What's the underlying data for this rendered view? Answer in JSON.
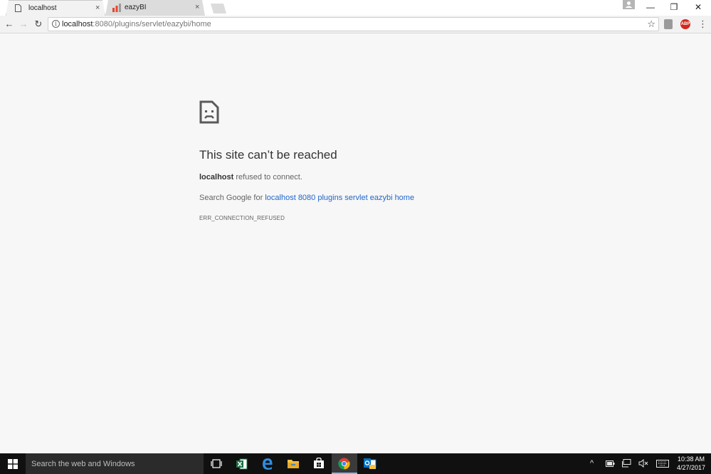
{
  "tabs": [
    {
      "title": "localhost",
      "close": "×",
      "icon": "page-icon"
    },
    {
      "title": "eazyBI",
      "close": "×",
      "icon": "bar-chart-icon"
    }
  ],
  "window_controls": {
    "minimize": "—",
    "restore": "❐",
    "close": "✕"
  },
  "toolbar": {
    "back": "←",
    "forward": "→",
    "reload": "↻",
    "url_host": "localhost",
    "url_path": ":8080/plugins/servlet/eazybi/home",
    "bookmark": "☆",
    "abp": "ABP",
    "menu": "⋮"
  },
  "error": {
    "title": "This site can’t be reached",
    "host": "localhost",
    "detail": " refused to connect.",
    "search_prefix": "Search Google for ",
    "search_link": "localhost 8080 plugins servlet eazybi home",
    "code": "ERR_CONNECTION_REFUSED"
  },
  "taskbar": {
    "search_placeholder": "Search the web and Windows",
    "apps": [
      "task-view-icon",
      "excel-icon",
      "edge-icon",
      "file-explorer-icon",
      "store-icon",
      "chrome-icon",
      "outlook-icon"
    ],
    "tray": {
      "chevron": "^",
      "battery": "▭",
      "network": "⌂",
      "volume": "🔇",
      "keyboard": "⌨"
    },
    "time": "10:38 AM",
    "date": "4/27/2017"
  },
  "colors": {
    "link": "#2167c8",
    "taskbar": "#101010",
    "page_bg": "#f7f7f7"
  }
}
